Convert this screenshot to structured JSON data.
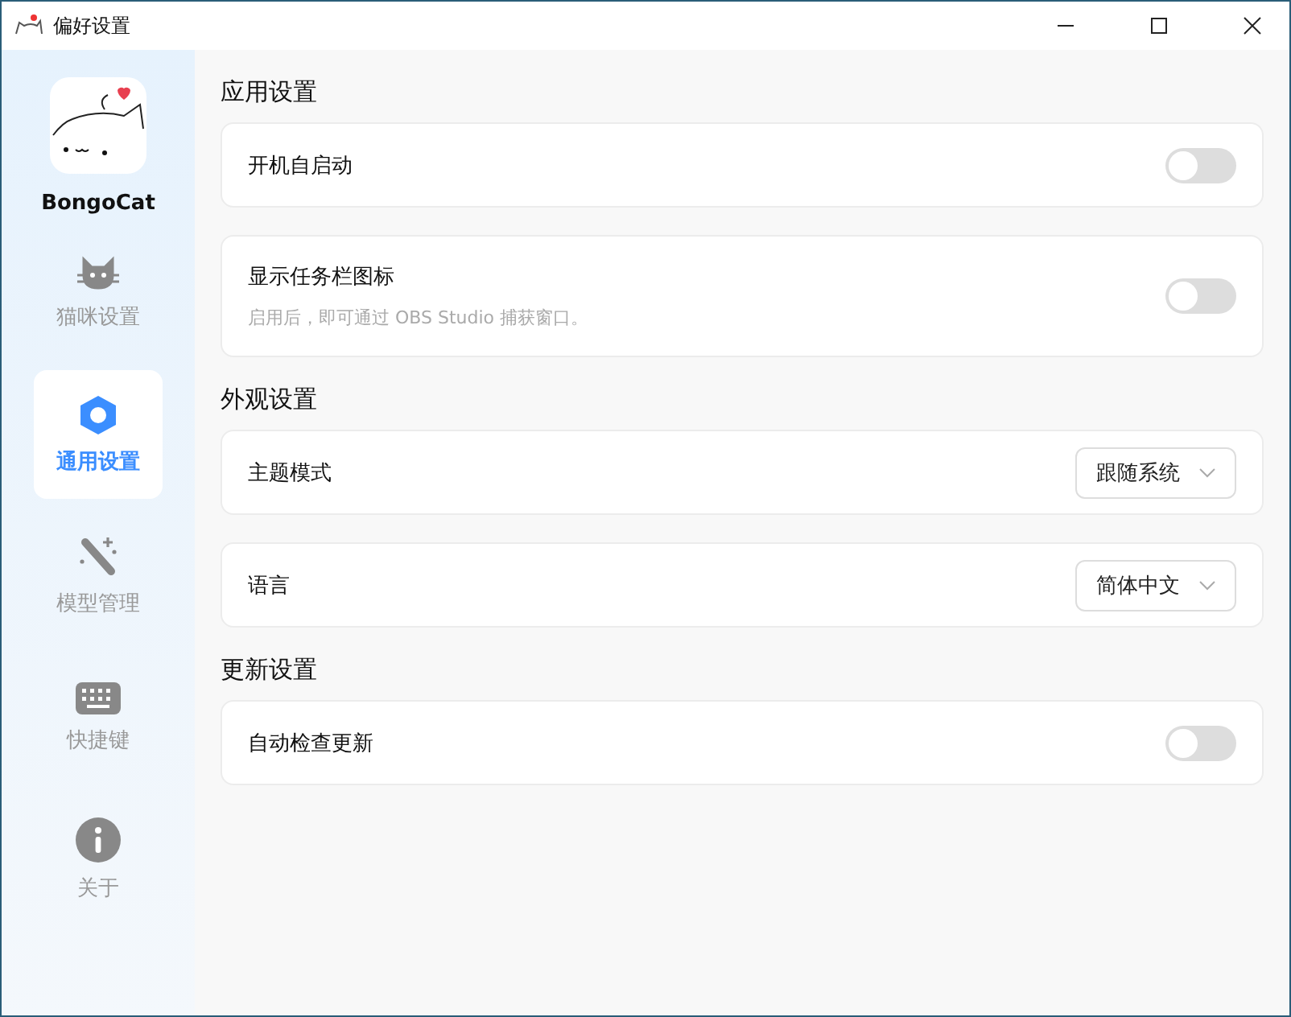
{
  "window": {
    "title": "偏好设置"
  },
  "sidebar": {
    "app_name": "BongoCat",
    "items": [
      {
        "label": "猫咪设置",
        "kind": "cat",
        "selected": false
      },
      {
        "label": "通用设置",
        "kind": "general",
        "selected": true
      },
      {
        "label": "模型管理",
        "kind": "models",
        "selected": false
      },
      {
        "label": "快捷键",
        "kind": "shortcuts",
        "selected": false
      },
      {
        "label": "关于",
        "kind": "about",
        "selected": false
      }
    ]
  },
  "sections": [
    {
      "title": "应用设置",
      "items": [
        {
          "kind": "toggle",
          "label": "开机自启动",
          "on": false
        },
        {
          "kind": "toggle",
          "label": "显示任务栏图标",
          "description": "启用后，即可通过 OBS Studio 捕获窗口。",
          "on": false
        }
      ]
    },
    {
      "title": "外观设置",
      "items": [
        {
          "kind": "select",
          "label": "主题模式",
          "value": "跟随系统"
        },
        {
          "kind": "select",
          "label": "语言",
          "value": "简体中文"
        }
      ]
    },
    {
      "title": "更新设置",
      "items": [
        {
          "kind": "toggle",
          "label": "自动检查更新",
          "on": false
        }
      ]
    }
  ]
}
